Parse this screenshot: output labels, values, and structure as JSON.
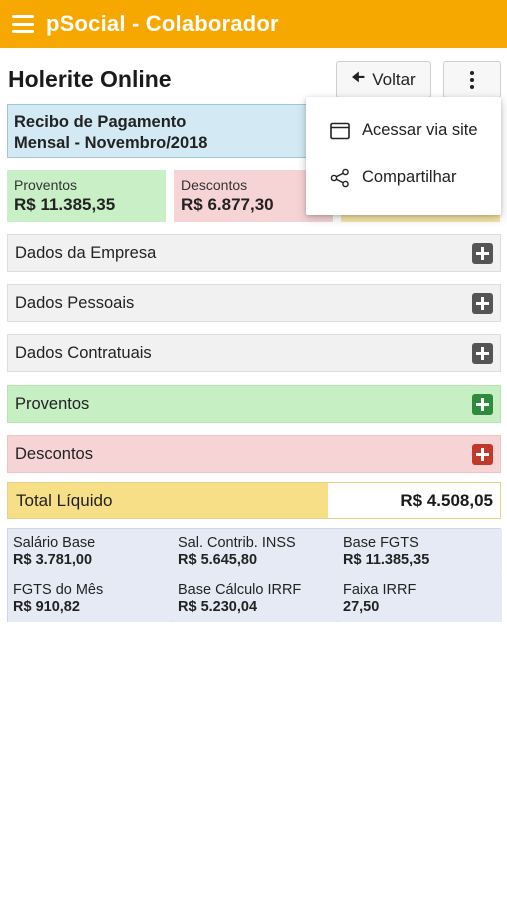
{
  "appbar": {
    "title": "pSocial - Colaborador"
  },
  "page": {
    "title": "Holerite Online",
    "back_label": "Voltar"
  },
  "recibo": {
    "line1": "Recibo de Pagamento",
    "line2": "Mensal - Novembro/2018"
  },
  "summary": {
    "proventos": {
      "label": "Proventos",
      "value": "R$ 11.385,35"
    },
    "descontos": {
      "label": "Descontos",
      "value": "R$ 6.877,30"
    }
  },
  "sections": [
    {
      "label": "Dados da Empresa"
    },
    {
      "label": "Dados Pessoais"
    },
    {
      "label": "Dados Contratuais"
    },
    {
      "label": "Proventos"
    },
    {
      "label": "Descontos"
    }
  ],
  "total": {
    "label": "Total Líquido",
    "value": "R$ 4.508,05"
  },
  "details": [
    {
      "label": "Salário Base",
      "value": "R$ 3.781,00"
    },
    {
      "label": "Sal. Contrib. INSS",
      "value": "R$ 5.645,80"
    },
    {
      "label": "Base FGTS",
      "value": "R$ 11.385,35"
    },
    {
      "label": "FGTS do Mês",
      "value": "R$ 910,82"
    },
    {
      "label": "Base Cálculo IRRF",
      "value": "R$ 5.230,04"
    },
    {
      "label": "Faixa IRRF",
      "value": "27,50"
    }
  ],
  "menu": {
    "items": [
      {
        "label": "Acessar via site",
        "icon": "browser-window-icon"
      },
      {
        "label": "Compartilhar",
        "icon": "share-icon"
      }
    ]
  },
  "colors": {
    "appbar": "#f7a800",
    "green": "#2e8b3e",
    "red": "#c0392b"
  }
}
